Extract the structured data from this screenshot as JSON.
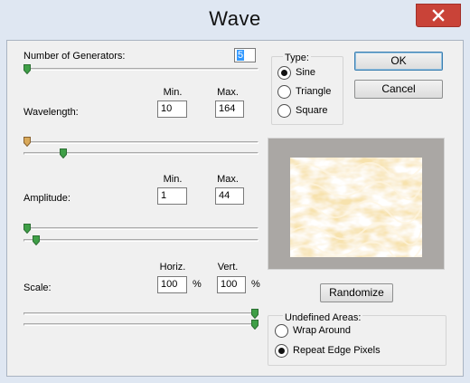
{
  "window": {
    "title": "Wave"
  },
  "generators": {
    "label": "Number of Generators:",
    "value": "5",
    "slider_fraction": 0.0
  },
  "wavelength": {
    "label": "Wavelength:",
    "min_header": "Min.",
    "max_header": "Max.",
    "min_value": "10",
    "max_value": "164",
    "min_slider_fraction": 0.0,
    "max_slider_fraction": 0.16
  },
  "amplitude": {
    "label": "Amplitude:",
    "min_header": "Min.",
    "max_header": "Max.",
    "min_value": "1",
    "max_value": "44",
    "min_slider_fraction": 0.0,
    "max_slider_fraction": 0.04
  },
  "scale": {
    "label": "Scale:",
    "horiz_header": "Horiz.",
    "vert_header": "Vert.",
    "horiz_value": "100",
    "vert_value": "100",
    "unit": "%",
    "horiz_slider_fraction": 1.0,
    "vert_slider_fraction": 1.0
  },
  "type": {
    "label": "Type:",
    "options": [
      {
        "label": "Sine",
        "selected": true
      },
      {
        "label": "Triangle",
        "selected": false
      },
      {
        "label": "Square",
        "selected": false
      }
    ]
  },
  "buttons": {
    "ok": "OK",
    "cancel": "Cancel",
    "randomize": "Randomize"
  },
  "undefined_areas": {
    "label": "Undefined Areas:",
    "options": [
      {
        "label": "Wrap Around",
        "selected": false
      },
      {
        "label": "Repeat Edge Pixels",
        "selected": true
      }
    ]
  },
  "colors": {
    "close_button": "#c94338",
    "default_button_border": "#3c7fb1",
    "preview_frame": "#aaa7a4"
  }
}
